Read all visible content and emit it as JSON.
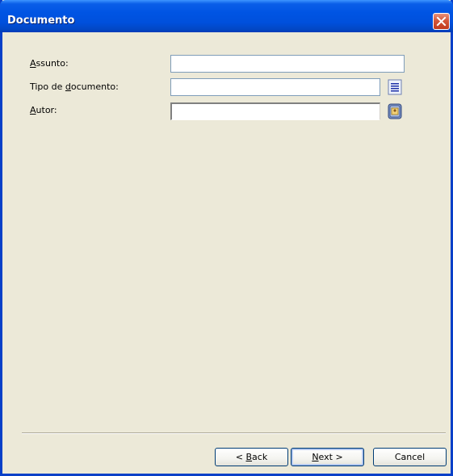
{
  "window": {
    "title": "Documento"
  },
  "form": {
    "fields": [
      {
        "label_prefix": "",
        "label_mnemonic": "A",
        "label_rest": "ssunto:",
        "value": ""
      },
      {
        "label_prefix": "Tipo de ",
        "label_mnemonic": "d",
        "label_rest": "ocumento:",
        "value": ""
      },
      {
        "label_prefix": "",
        "label_mnemonic": "A",
        "label_rest": "utor:",
        "value": ""
      }
    ]
  },
  "buttons": {
    "back": {
      "lt": "< ",
      "mnemonic": "B",
      "rest": "ack"
    },
    "next": {
      "mnemonic": "N",
      "rest": "ext",
      "gt": " >"
    },
    "cancel": "Cancel"
  },
  "icons": {
    "doc_type_picker": "list-icon",
    "author_picker": "address-book-icon",
    "close": "close-icon"
  },
  "colors": {
    "title_bar": "#0054e3",
    "dialog_background": "#ece9d8",
    "close_button": "#d4573a"
  }
}
